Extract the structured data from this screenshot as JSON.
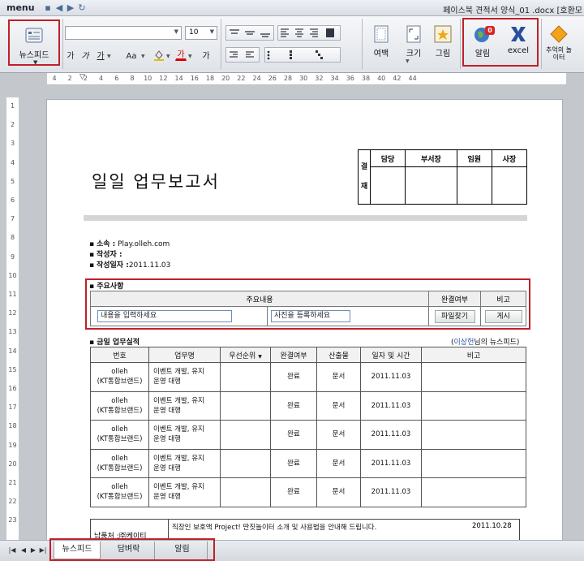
{
  "titlebar": {
    "menu": "menu",
    "title": "페이스북 견적서 양식_01 .docx [호환모"
  },
  "ribbon": {
    "newsfeed": "뉴스피드",
    "font_size": "10",
    "fmt": [
      "가",
      "가",
      "가",
      "Aa",
      "가",
      "가",
      "가"
    ],
    "margin": "여백",
    "size": "크기",
    "picture": "그림",
    "alarm": "알림",
    "alarm_badge": "0",
    "excel": "excel",
    "memory": "추억의 놀이터"
  },
  "ruler": {
    "h": [
      "4",
      "2",
      "2",
      "4",
      "6",
      "8",
      "10",
      "12",
      "14",
      "16",
      "18",
      "20",
      "22",
      "24",
      "26",
      "28",
      "30",
      "32",
      "34",
      "36",
      "38",
      "40",
      "42",
      "44"
    ],
    "v": [
      "1",
      "2",
      "3",
      "4",
      "5",
      "6",
      "7",
      "8",
      "9",
      "10",
      "11",
      "12",
      "13",
      "14",
      "15",
      "16",
      "17",
      "18",
      "19",
      "20",
      "21",
      "22",
      "23"
    ]
  },
  "doc": {
    "title": "일일 업무보고서",
    "approval": {
      "side_top": "결",
      "side_bottom": "재",
      "headers": [
        "담당",
        "부서장",
        "임원",
        "사장"
      ]
    },
    "info": [
      {
        "label": "소속 :",
        "value": " Play.olleh.com"
      },
      {
        "label": "작성자 :",
        "value": ""
      },
      {
        "label": "작성일자 :",
        "value": "2011.11.03"
      }
    ],
    "summary": {
      "title": "주요사항",
      "h_content": "주요내용",
      "h_done": "완결여부",
      "h_note": "비고",
      "input_text": "내용을 입력하세요",
      "input_photo": "사진을 등록하세요",
      "btn_file": "파일찾기",
      "btn_post": "게시"
    },
    "perf": {
      "title": "금일 업무실적",
      "source_open": "(",
      "source_name": "이상헌",
      "source_close": "님의 뉴스피드)",
      "headers": [
        "번호",
        "업무명",
        "우선순위",
        "완결여부",
        "산출물",
        "일자 및 시간",
        "비고"
      ],
      "rows": [
        {
          "no": "olleh\n(KT통합브랜드)",
          "task": "이벤트 개발, 유지\n운영 대행",
          "priority": "",
          "done": "완료",
          "output": "문서",
          "date": "2011.11.03",
          "note": ""
        },
        {
          "no": "olleh\n(KT통합브랜드)",
          "task": "이벤트 개발, 유지\n운영 대행",
          "priority": "",
          "done": "완료",
          "output": "문서",
          "date": "2011.11.03",
          "note": ""
        },
        {
          "no": "olleh\n(KT통합브랜드)",
          "task": "이벤트 개발, 유지\n운영 대행",
          "priority": "",
          "done": "완료",
          "output": "문서",
          "date": "2011.11.03",
          "note": ""
        },
        {
          "no": "olleh\n(KT통합브랜드)",
          "task": "이벤트 개발, 유지\n운영 대행",
          "priority": "",
          "done": "완료",
          "output": "문서",
          "date": "2011.11.03",
          "note": ""
        },
        {
          "no": "olleh\n(KT통합브랜드)",
          "task": "이벤트 개발, 유지\n운영 대행",
          "priority": "",
          "done": "완료",
          "output": "문서",
          "date": "2011.11.03",
          "note": ""
        }
      ]
    },
    "news": {
      "source": "납품처 :㈜케이티",
      "item": "직장인 보호액 Project! 딴짓놀이터 소개 및 사용법을 안내해 드립니다.",
      "date": "2011.10.28"
    }
  },
  "tabs": [
    "뉴스피드",
    "담벼락",
    "알림"
  ],
  "colors": {
    "highlight": "#c0202a",
    "link": "#2e57a6"
  }
}
